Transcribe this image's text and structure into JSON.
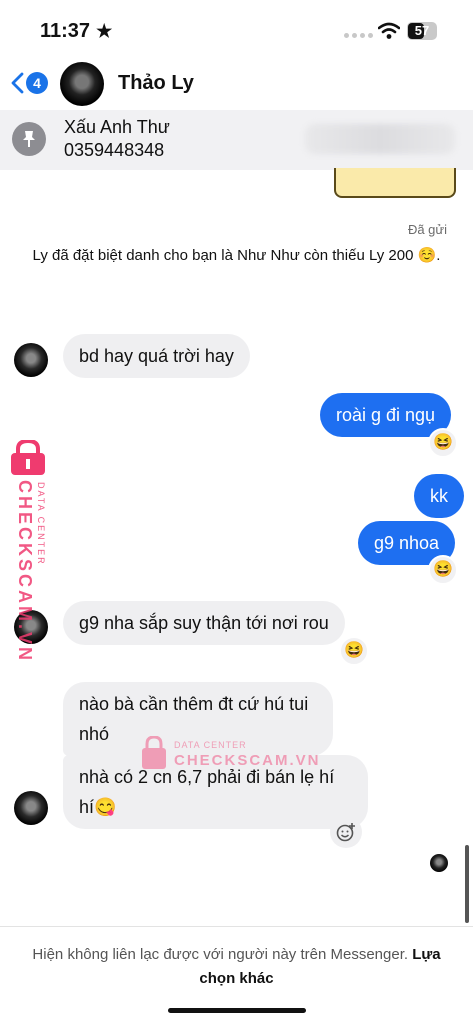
{
  "status_bar": {
    "time": "11:37",
    "battery": "57",
    "battery_level": 0.57
  },
  "header": {
    "back_count": "4",
    "contact_name": "Thảo Ly"
  },
  "pinned": {
    "line1": "Xấu Anh Thư",
    "line2": "0359448348"
  },
  "sent_status": "Đã gửi",
  "system_message": "Ly đã đặt biệt danh cho bạn là Như Như còn thiếu Ly 200 ☺️.",
  "messages": [
    {
      "direction": "in",
      "text": "bd hay quá trời hay"
    },
    {
      "direction": "out",
      "text": "roài g đi ngụ",
      "reaction": "😆"
    },
    {
      "direction": "out",
      "text": "kk"
    },
    {
      "direction": "out",
      "text": "g9 nhoa",
      "reaction": "😆"
    },
    {
      "direction": "in",
      "text": "g9 nha sắp suy thận tới nơi rou",
      "reaction": "😆"
    },
    {
      "direction": "in",
      "text": "nào bà cần thêm đt cứ hú tui nhó"
    },
    {
      "direction": "in",
      "text": "nhà có 2 cn 6,7 phải đi bán lẹ hí hí😋"
    }
  ],
  "footer": {
    "text": "Hiện không liên lạc được với người này trên Messenger.",
    "link": "Lựa chọn khác"
  },
  "watermark": {
    "brand": "CHECKSCAM.VN",
    "sub": "DATA CENTER"
  },
  "colors": {
    "accent": "#1e6ff1",
    "incoming_bubble": "#efeff1",
    "watermark": "#ef3b6f"
  },
  "icons": [
    "star-icon",
    "signal-icon",
    "wifi-icon",
    "battery-icon",
    "back-chevron-icon",
    "pin-icon",
    "add-reaction-icon",
    "lock-icon"
  ]
}
